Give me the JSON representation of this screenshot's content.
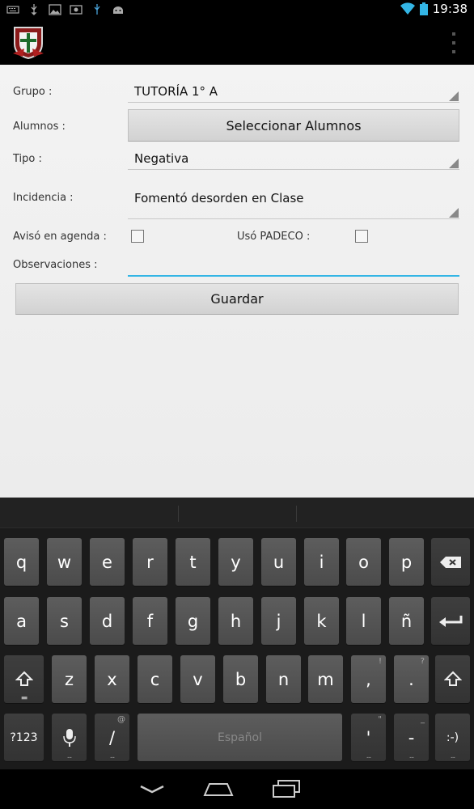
{
  "status_bar": {
    "time": "19:38",
    "icons": [
      "keyboard-icon",
      "usb-icon",
      "image-icon",
      "screenshot-icon",
      "usb-icon",
      "android-icon",
      "wifi-icon",
      "battery-icon"
    ]
  },
  "action_bar": {
    "logo": "school-crest-logo",
    "overflow_icon": "overflow-menu-icon"
  },
  "form": {
    "grupo": {
      "label": "Grupo :",
      "value": "TUTORÍA 1° A"
    },
    "alumnos": {
      "label": "Alumnos :",
      "button": "Seleccionar Alumnos"
    },
    "tipo": {
      "label": "Tipo :",
      "value": "Negativa"
    },
    "incidencia": {
      "label": "Incidencia :",
      "value": "Fomentó desorden en Clase"
    },
    "aviso": {
      "label": "Avisó en agenda :",
      "checked": false
    },
    "padeco": {
      "label": "Usó PADECO :",
      "checked": false
    },
    "observaciones": {
      "label": "Observaciones :",
      "value": ""
    },
    "save_button": "Guardar"
  },
  "colors": {
    "accent": "#33b5e5",
    "background": "#f0f0f0",
    "keyboard_bg": "#1b1b1b"
  },
  "keyboard": {
    "row1": [
      "q",
      "w",
      "e",
      "r",
      "t",
      "y",
      "u",
      "i",
      "o",
      "p"
    ],
    "row2": [
      "a",
      "s",
      "d",
      "f",
      "g",
      "h",
      "j",
      "k",
      "l",
      "ñ"
    ],
    "row3": [
      "z",
      "x",
      "c",
      "v",
      "b",
      "n",
      "m"
    ],
    "comma": ",",
    "period": ".",
    "comma_hint": "!",
    "period_hint": "?",
    "symbols_key": "?123",
    "slash": "/",
    "slash_hint": "@",
    "space_label": "Español",
    "apostrophe": "'",
    "apostrophe_hint": "\"",
    "dash": "-",
    "dash_hint": "_",
    "smiley": ":-)"
  }
}
